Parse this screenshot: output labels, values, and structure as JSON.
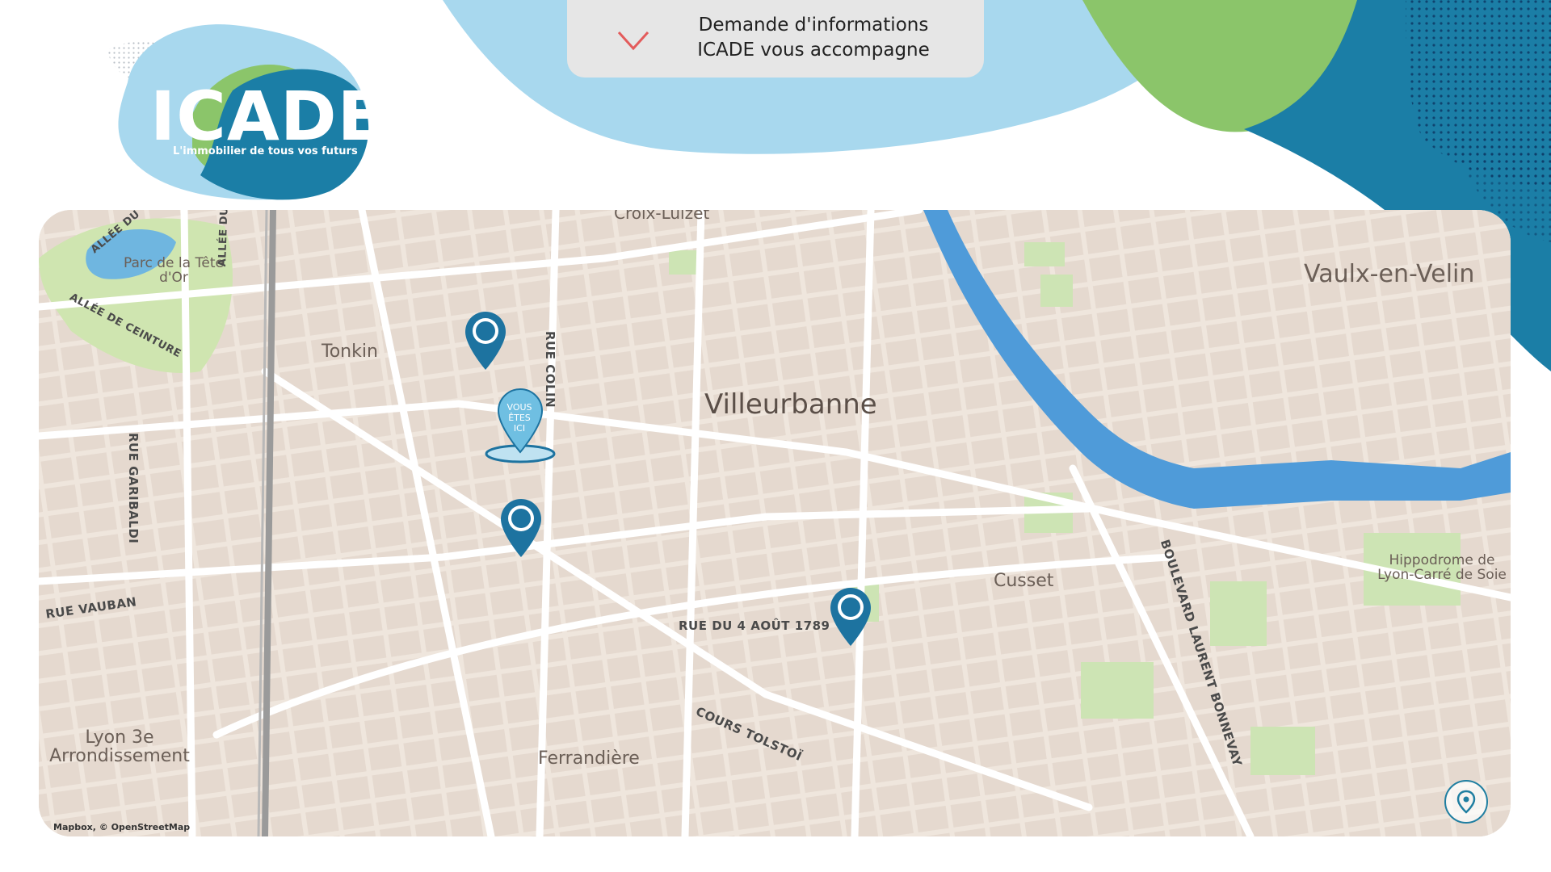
{
  "brand": {
    "name": "ICADE",
    "tagline": "L'immobilier de tous vos futurs"
  },
  "info_request": {
    "line1": "Demande d'informations",
    "line2": "ICADE vous accompagne",
    "icon": "chevron-down-icon"
  },
  "map": {
    "place_labels": {
      "croix_luizet": "Croix-Luizet",
      "vaulx_en_velin": "Vaulx-en-Velin",
      "parc_tete_dor": "Parc de la Tête d'Or",
      "tonkin": "Tonkin",
      "villeurbanne": "Villeurbanne",
      "cusset": "Cusset",
      "hippodrome": "Hippodrome de Lyon-Carré de Soie",
      "lyon_3e": "Lyon 3e Arrondissement",
      "ferrandiere": "Ferrandière"
    },
    "street_labels": {
      "allee_du": "ALLÉE DU",
      "chemin_de": "ALLÉE DU CHEMIN DE",
      "allee_ceinture": "ALLÉE DE CEINTURE",
      "rue_colin": "RUE COLIN",
      "rue_garibaldi": "RUE GARIBALDI",
      "rue_vauban": "RUE VAUBAN",
      "rue_4_aout": "RUE DU 4 AOÛT 1789",
      "cours_tolstoi": "COURS TOLSTOÏ",
      "boulevard_bonnevay": "BOULEVARD LAURENT BONNEVAY"
    },
    "you_are_here": {
      "line1": "VOUS",
      "line2": "ÊTES",
      "line3": "ICI"
    },
    "attribution": "Mapbox, © OpenStreetMap",
    "locate_icon": "location-pin-icon"
  },
  "colors": {
    "brand_blue": "#1f7ea1",
    "light_blue": "#a8d8ee",
    "green": "#8bc56a",
    "dark_blue": "#1b7ea6",
    "marker_blue": "#1d73a0",
    "chevron_red": "#e35b5b"
  }
}
